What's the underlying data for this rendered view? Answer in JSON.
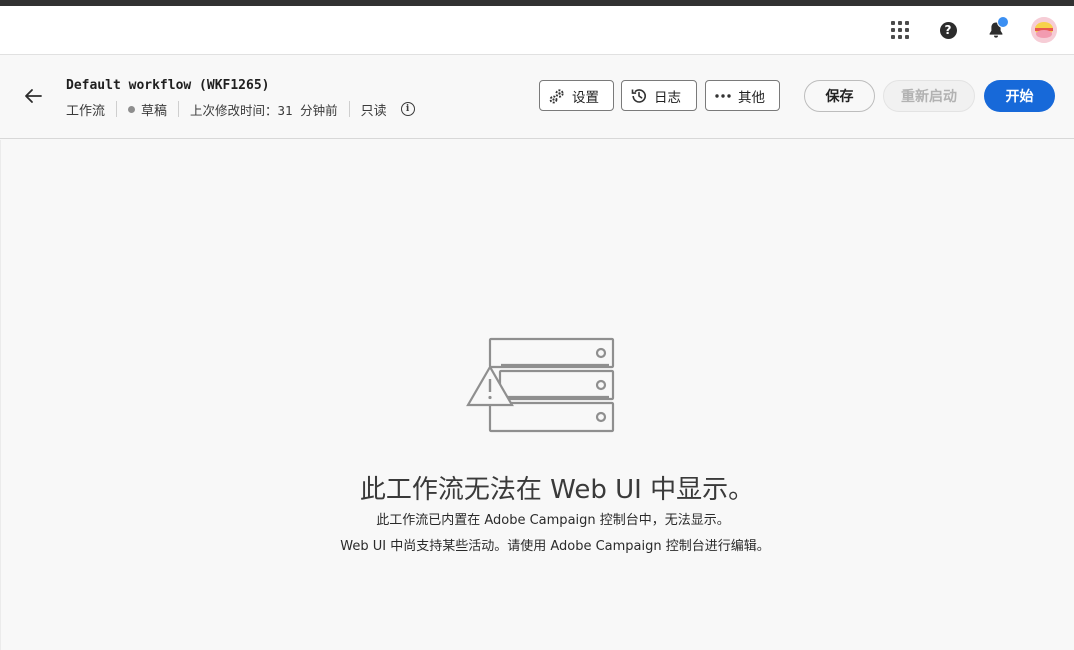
{
  "topbar": {
    "icons": [
      "apps-grid-icon",
      "help-icon",
      "bell-icon",
      "avatar"
    ],
    "help_glyph": "?",
    "notification_badge_color": "#3b8ff2"
  },
  "header": {
    "back_icon": "arrow-left-icon",
    "title": "Default workflow (WKF1265)",
    "type": "工作流",
    "status": "草稿",
    "modified": "上次修改时间：31 分钟前",
    "mode": "只读",
    "info_glyph": "i",
    "buttons": {
      "settings": "设置",
      "log": "日志",
      "more": "其他",
      "save": "保存",
      "restart": "重新启动",
      "start": "开始"
    },
    "accent_color": "#1769d9"
  },
  "empty_state": {
    "icon": "server-warning-icon",
    "title": "此工作流无法在 Web UI 中显示。",
    "line1": "此工作流已内置在 Adobe Campaign 控制台中，无法显示。",
    "line2": "Web UI 中尚支持某些活动。请使用 Adobe Campaign 控制台进行编辑。"
  }
}
